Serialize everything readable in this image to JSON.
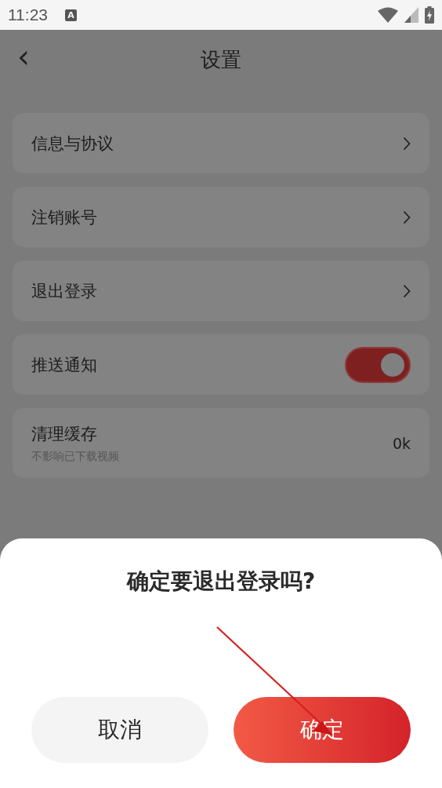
{
  "status_bar": {
    "time": "11:23",
    "notification_icon": "A"
  },
  "header": {
    "back": "‹",
    "title": "设置"
  },
  "settings": [
    {
      "kind": "link",
      "label": "信息与协议"
    },
    {
      "kind": "link",
      "label": "注销账号"
    },
    {
      "kind": "link",
      "label": "退出登录"
    },
    {
      "kind": "toggle",
      "label": "推送通知",
      "on": true
    },
    {
      "kind": "value",
      "label": "清理缓存",
      "subtitle": "不影响已下载视频",
      "value": "0k"
    }
  ],
  "dialog": {
    "title": "确定要退出登录吗?",
    "buttons": [
      {
        "kind": "secondary",
        "label": "取消"
      },
      {
        "kind": "primary",
        "label": "确定"
      }
    ]
  }
}
